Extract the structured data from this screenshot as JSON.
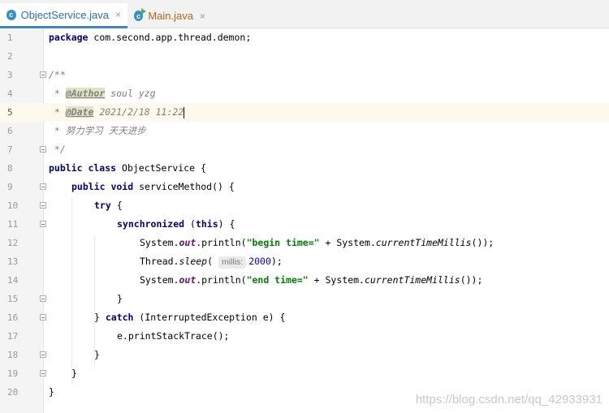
{
  "tabs": [
    {
      "icon": "class-icon",
      "label": "ObjectService.java",
      "close": "×",
      "active": true
    },
    {
      "icon": "runnable-class-icon",
      "label": "Main.java",
      "close": "×",
      "active": false
    }
  ],
  "icon_letter": "c",
  "lines": [
    {
      "n": "1"
    },
    {
      "n": "2"
    },
    {
      "n": "3"
    },
    {
      "n": "4"
    },
    {
      "n": "5"
    },
    {
      "n": "6"
    },
    {
      "n": "7"
    },
    {
      "n": "8"
    },
    {
      "n": "9"
    },
    {
      "n": "10"
    },
    {
      "n": "11"
    },
    {
      "n": "12"
    },
    {
      "n": "13"
    },
    {
      "n": "14"
    },
    {
      "n": "15"
    },
    {
      "n": "16"
    },
    {
      "n": "17"
    },
    {
      "n": "18"
    },
    {
      "n": "19"
    },
    {
      "n": "20"
    }
  ],
  "code": {
    "l1_kw": "package",
    "l1_rest": " com.second.app.thread.demon;",
    "l3": "/**",
    "l4_star": " * ",
    "l4_tag": "@Author",
    "l4_rest": " soul yzg",
    "l5_star": " * ",
    "l5_tag": "@Date",
    "l5_rest": " 2021/2/18 11:22",
    "l6": " * 努力学习 天天进步",
    "l7": " */",
    "l8_kw": "public class",
    "l8_rest": " ObjectService {",
    "l9_kw": "public void",
    "l9_rest": " serviceMethod() {",
    "l10_kw": "try",
    "l10_rest": " {",
    "l11_kw": "synchronized",
    "l11_a": " (",
    "l11_this": "this",
    "l11_b": ") {",
    "l12_a": "System.",
    "l12_out": "out",
    "l12_b": ".println(",
    "l12_str": "\"begin time=\"",
    "l12_c": " + System.",
    "l12_m": "currentTimeMillis",
    "l12_d": "());",
    "l13_a": "Thread.",
    "l13_m": "sleep",
    "l13_b": "( ",
    "l13_hint": "millis:",
    "l13_num": "2000",
    "l13_c": ");",
    "l14_a": "System.",
    "l14_out": "out",
    "l14_b": ".println(",
    "l14_str": "\"end time=\"",
    "l14_c": " + System.",
    "l14_m": "currentTimeMillis",
    "l14_d": "());",
    "l15": "}",
    "l16_a": "} ",
    "l16_kw": "catch",
    "l16_b": " (InterruptedException e) {",
    "l17": "e.printStackTrace();",
    "l18": "}",
    "l19": "}",
    "l20": "}"
  },
  "watermark": "https://blog.csdn.net/qq_42933931",
  "colors": {
    "keyword": "#000080",
    "string": "#008000",
    "number": "#0000ff",
    "comment": "#808080",
    "static_field": "#660e7a",
    "tab_accent": "#4083c9"
  }
}
